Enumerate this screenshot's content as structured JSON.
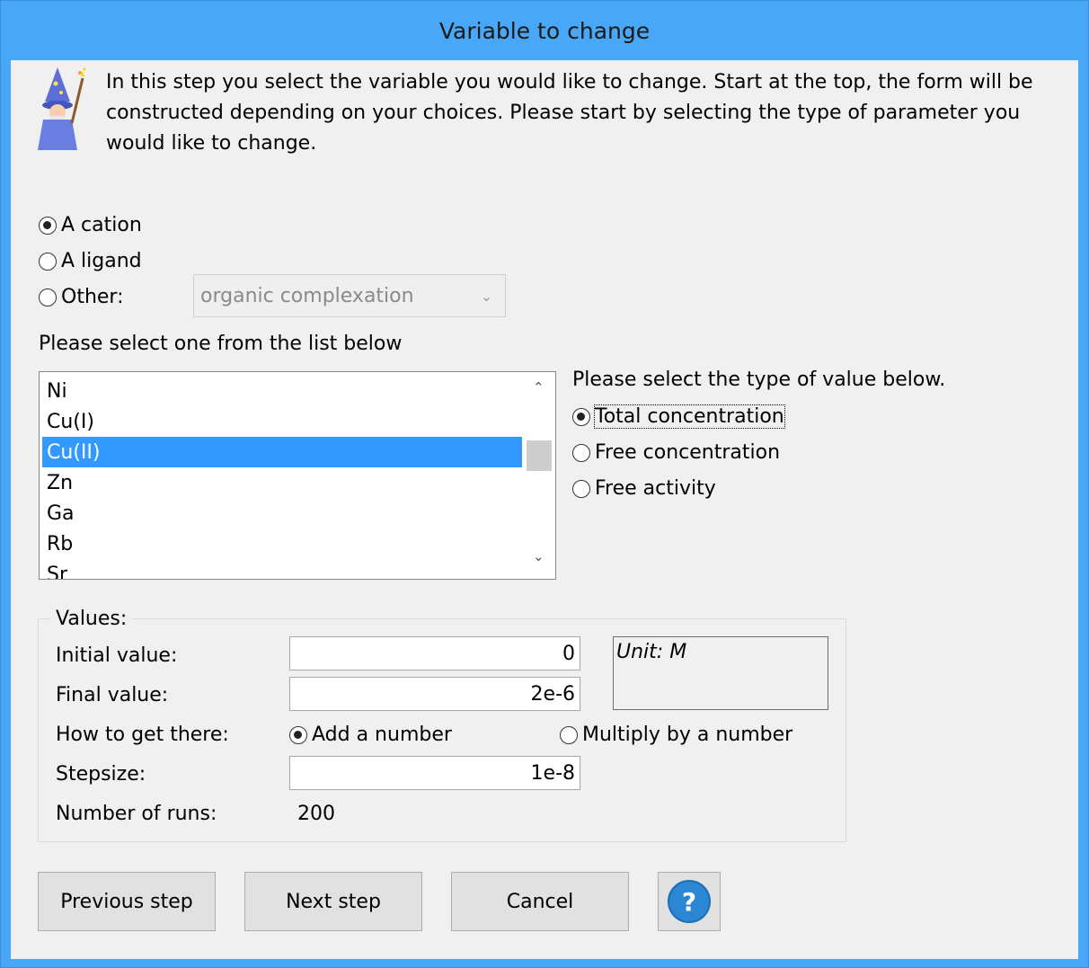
{
  "window": {
    "title": "Variable to change"
  },
  "intro": {
    "text": "In this step you select the variable you would like to change.  Start at the top, the form will be constructed depending on your choices. Please start by selecting the type of parameter you would like to change.",
    "icon": "wizard-icon"
  },
  "param_type": {
    "options": [
      {
        "label": "A cation",
        "selected": true
      },
      {
        "label": "A ligand",
        "selected": false
      },
      {
        "label": "Other:",
        "selected": false
      }
    ],
    "other_select": {
      "value": "organic complexation",
      "enabled": false
    }
  },
  "list": {
    "prompt": "Please select one from the list below",
    "items": [
      "Ni",
      "Cu(I)",
      "Cu(II)",
      "Zn",
      "Ga",
      "Rb",
      "Sr"
    ],
    "selected": "Cu(II)"
  },
  "value_type": {
    "prompt": "Please select the type of value below.",
    "options": [
      {
        "label": "Total concentration",
        "selected": true
      },
      {
        "label": "Free concentration",
        "selected": false
      },
      {
        "label": "Free activity",
        "selected": false
      }
    ]
  },
  "values": {
    "group_label": "Values:",
    "initial_label": "Initial value:",
    "initial_value": "0",
    "final_label": "Final value:",
    "final_value": "2e-6",
    "how_label": "How to get there:",
    "how_options": [
      {
        "label": "Add a number",
        "selected": true
      },
      {
        "label": "Multiply by a number",
        "selected": false
      }
    ],
    "step_label": "Stepsize:",
    "step_value": "1e-8",
    "runs_label": "Number of runs:",
    "runs_value": "200",
    "unit_text": "Unit: M"
  },
  "buttons": {
    "previous": "Previous step",
    "next": "Next step",
    "cancel": "Cancel",
    "help": "?"
  },
  "colors": {
    "titlebar": "#48a7f7",
    "selection": "#3399ff",
    "help": "#2b86d4"
  }
}
